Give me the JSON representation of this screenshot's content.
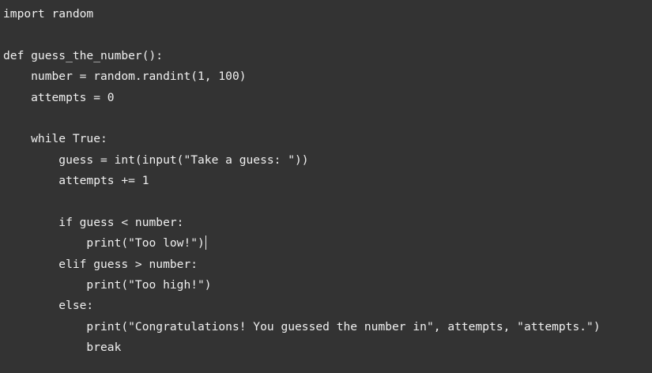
{
  "editor": {
    "lines": [
      "import random",
      "",
      "def guess_the_number():",
      "    number = random.randint(1, 100)",
      "    attempts = 0",
      "",
      "    while True:",
      "        guess = int(input(\"Take a guess: \"))",
      "        attempts += 1",
      "",
      "        if guess < number:",
      "            print(\"Too low!\")",
      "        elif guess > number:",
      "            print(\"Too high!\")",
      "        else:",
      "            print(\"Congratulations! You guessed the number in\", attempts, \"attempts.\")",
      "            break"
    ],
    "cursor_line": 12
  }
}
